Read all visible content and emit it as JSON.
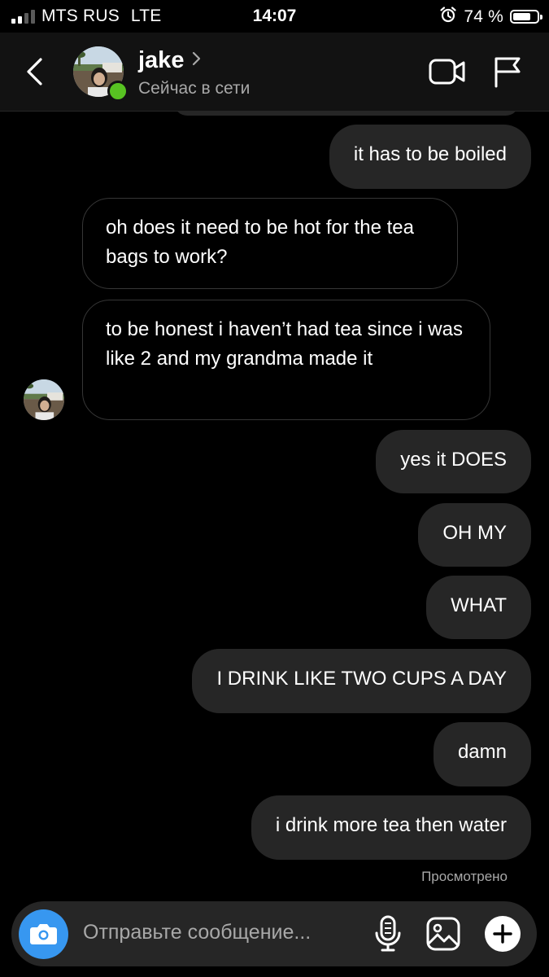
{
  "status_bar": {
    "carrier": "MTS RUS",
    "network": "LTE",
    "time": "14:07",
    "battery": "74 %",
    "battery_level": 0.74,
    "signal_bars": 2
  },
  "header": {
    "username": "jake",
    "status": "Сейчас в сети"
  },
  "messages": [
    {
      "side": "out",
      "text": "it has to be boiled"
    },
    {
      "side": "in",
      "text": "oh does it need to be hot for the tea bags to work?"
    },
    {
      "side": "in",
      "text": "to be honest i haven’t had tea since i was like 2 and my grandma made it"
    },
    {
      "side": "out",
      "text": "yes it DOES"
    },
    {
      "side": "out",
      "text": "OH MY"
    },
    {
      "side": "out",
      "text": "WHAT"
    },
    {
      "side": "out",
      "text": "I DRINK LIKE TWO CUPS A DAY"
    },
    {
      "side": "out",
      "text": "damn"
    },
    {
      "side": "out",
      "text": "i drink more tea then water"
    }
  ],
  "seen_label": "Просмотрено",
  "composer": {
    "placeholder": "Отправьте сообщение..."
  },
  "colors": {
    "background": "#000000",
    "header": "#121212",
    "bubble": "#262626",
    "accent": "#3797f0",
    "online": "#58c322",
    "muted_text": "#a8a8a8"
  },
  "icons": [
    "back-icon",
    "chevron-right-icon",
    "video-call-icon",
    "flag-icon",
    "camera-icon",
    "microphone-icon",
    "gallery-icon",
    "plus-icon"
  ]
}
